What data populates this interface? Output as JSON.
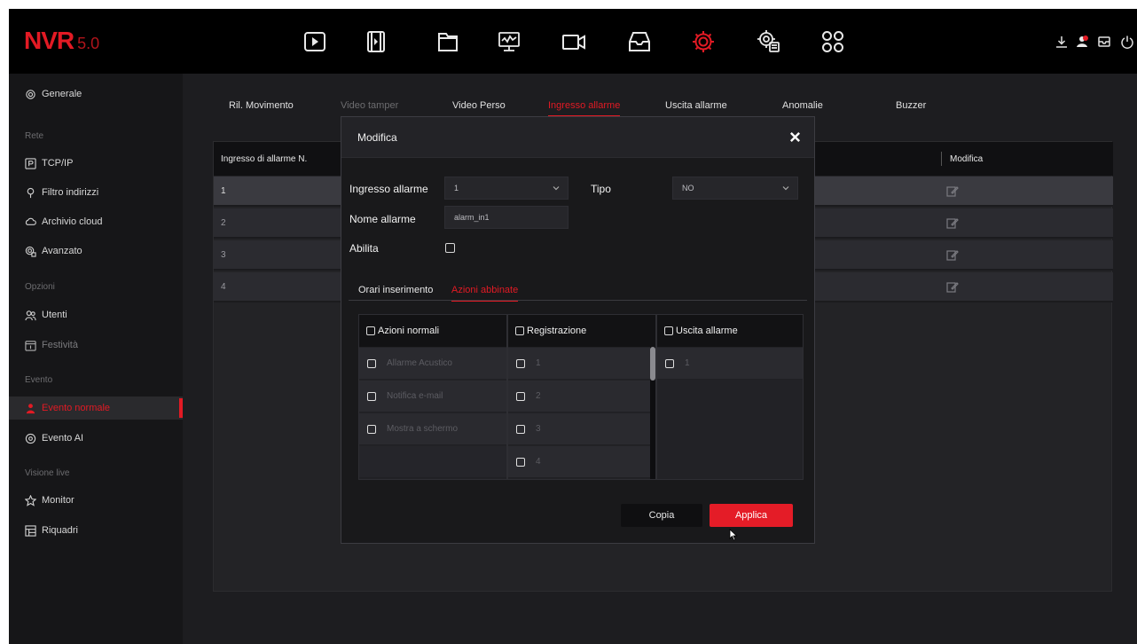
{
  "header": {
    "logo_main": "NVR",
    "logo_version": "5.0",
    "nav_icons": [
      "playback-icon",
      "video-clip-icon",
      "folder-icon",
      "monitor-graph-icon",
      "camera-icon",
      "storage-tray-icon",
      "settings-gear-icon",
      "system-settings-icon",
      "apps-grid-icon"
    ],
    "active_nav": "settings-gear-icon",
    "right_icons": [
      "download-icon",
      "alarm-user-icon",
      "message-icon",
      "power-icon"
    ]
  },
  "sidebar": {
    "generale": "Generale",
    "rete_section": "Rete",
    "tcpip": "TCP/IP",
    "filtro": "Filtro indirizzi",
    "cloud": "Archivio cloud",
    "avanzato": "Avanzato",
    "opzioni_section": "Opzioni",
    "utenti": "Utenti",
    "festivita": "Festività",
    "evento_section": "Evento",
    "evento_normale": "Evento normale",
    "evento_ai": "Evento AI",
    "visione_section": "Visione live",
    "monitor": "Monitor",
    "riquadri": "Riquadri"
  },
  "tabs": {
    "ril_movimento": "Ril. Movimento",
    "video_tamper": "Video tamper",
    "video_perso": "Video Perso",
    "ingresso_allarme": "Ingresso allarme",
    "uscita_allarme": "Uscita allarme",
    "anomalie": "Anomalie",
    "buzzer": "Buzzer"
  },
  "table": {
    "col_ingresso": "Ingresso di allarme N.",
    "col_modifica": "Modifica",
    "rows": [
      "1",
      "2",
      "3",
      "4"
    ]
  },
  "modal": {
    "title": "Modifica",
    "ingresso_label": "Ingresso allarme",
    "ingresso_value": "1",
    "tipo_label": "Tipo",
    "tipo_value": "NO",
    "nome_label": "Nome allarme",
    "nome_value": "alarm_in1",
    "abilita_label": "Abilita",
    "subtab_orari": "Orari inserimento",
    "subtab_azioni": "Azioni abbinate",
    "col_azioni_header": "Azioni normali",
    "azioni_items": [
      "Allarme Acustico",
      "Notifica e-mail",
      "Mostra a schermo"
    ],
    "col_registrazione_header": "Registrazione",
    "registrazione_items": [
      "1",
      "2",
      "3",
      "4"
    ],
    "col_uscita_header": "Uscita allarme",
    "uscita_items": [
      "1"
    ],
    "copia_button": "Copia",
    "applica_button": "Applica"
  },
  "colors": {
    "accent": "#e21a24",
    "background": "#1b1b1d",
    "topbar": "#000000"
  }
}
